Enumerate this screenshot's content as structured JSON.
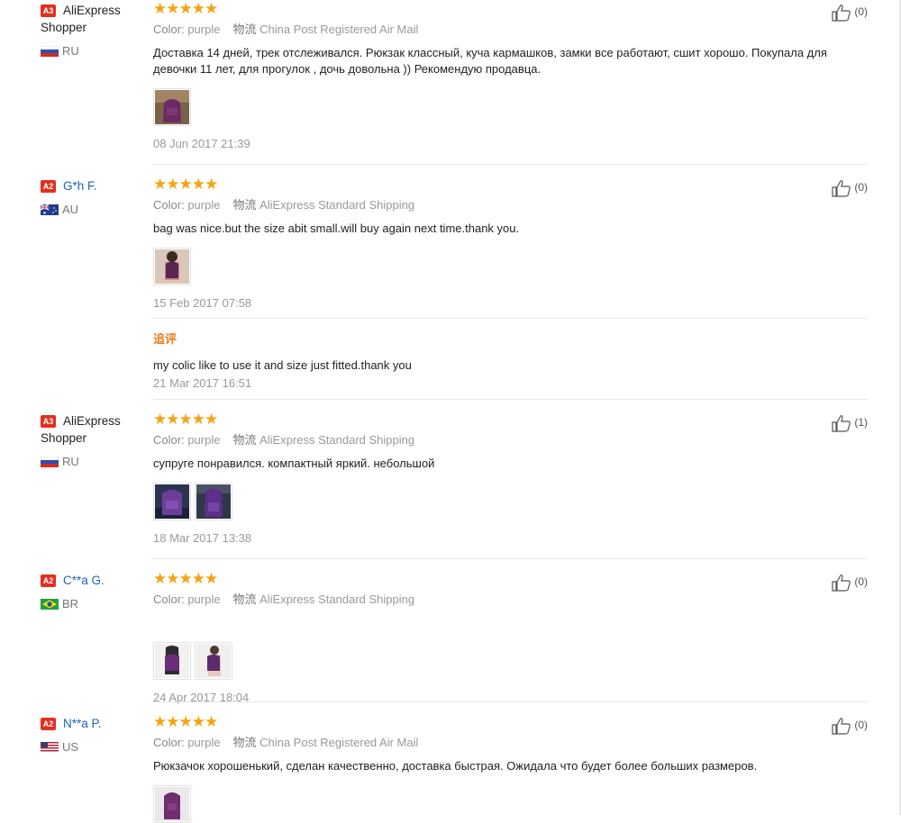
{
  "labels": {
    "color": "Color:",
    "logistics": "物流",
    "followup_head": "追评"
  },
  "reviews": [
    {
      "level": "A3",
      "name": "AliExpress Shopper",
      "country": "RU",
      "color": "purple",
      "shipping": "China Post Registered Air Mail",
      "text": "Доставка 14 дней, трек отслеживался. Рюкзак классный, куча кармашков, замки все работают, сшит хорошо. Покупала для девочки 11 лет, для прогулок , дочь довольна )) Рекомендую продавца.",
      "date": "08 Jun 2017 21:39",
      "likes": "(0)"
    },
    {
      "level": "A2",
      "name": "G*h F.",
      "country": "AU",
      "color": "purple",
      "shipping": "AliExpress Standard Shipping",
      "text": "bag was nice.but the size abit small.will buy again next time.thank you.",
      "date": "15 Feb 2017 07:58",
      "likes": "(0)",
      "followup": {
        "text": "my colic like to use it and size just fitted.thank you",
        "date": "21 Mar 2017 16:51"
      }
    },
    {
      "level": "A3",
      "name": "AliExpress Shopper",
      "country": "RU",
      "color": "purple",
      "shipping": "AliExpress Standard Shipping",
      "text": "супруге понравился. компактный яркий. небольшой",
      "date": "18 Mar 2017 13:38",
      "likes": "(1)"
    },
    {
      "level": "A2",
      "name": "C**a G.",
      "country": "BR",
      "color": "purple",
      "shipping": "AliExpress Standard Shipping",
      "text": "",
      "date": "24 Apr 2017 18:04",
      "likes": "(0)"
    },
    {
      "level": "A2",
      "name": "N**a P.",
      "country": "US",
      "color": "purple",
      "shipping": "China Post Registered Air Mail",
      "text": "Рюкзачок хорошенький, сделан качественно, доставка быстрая. Ожидала что будет более больших размеров.",
      "date": "",
      "likes": "(0)"
    }
  ],
  "colors": {
    "accent_star": "#f6a310",
    "level_badge": "#e0301e",
    "link_blue": "#2261b5",
    "followup_orange": "#e67e22"
  },
  "icons": {
    "rating": "star-icon",
    "like": "thumbs-up-icon",
    "photo": "backpack-photo-thumbnail"
  }
}
